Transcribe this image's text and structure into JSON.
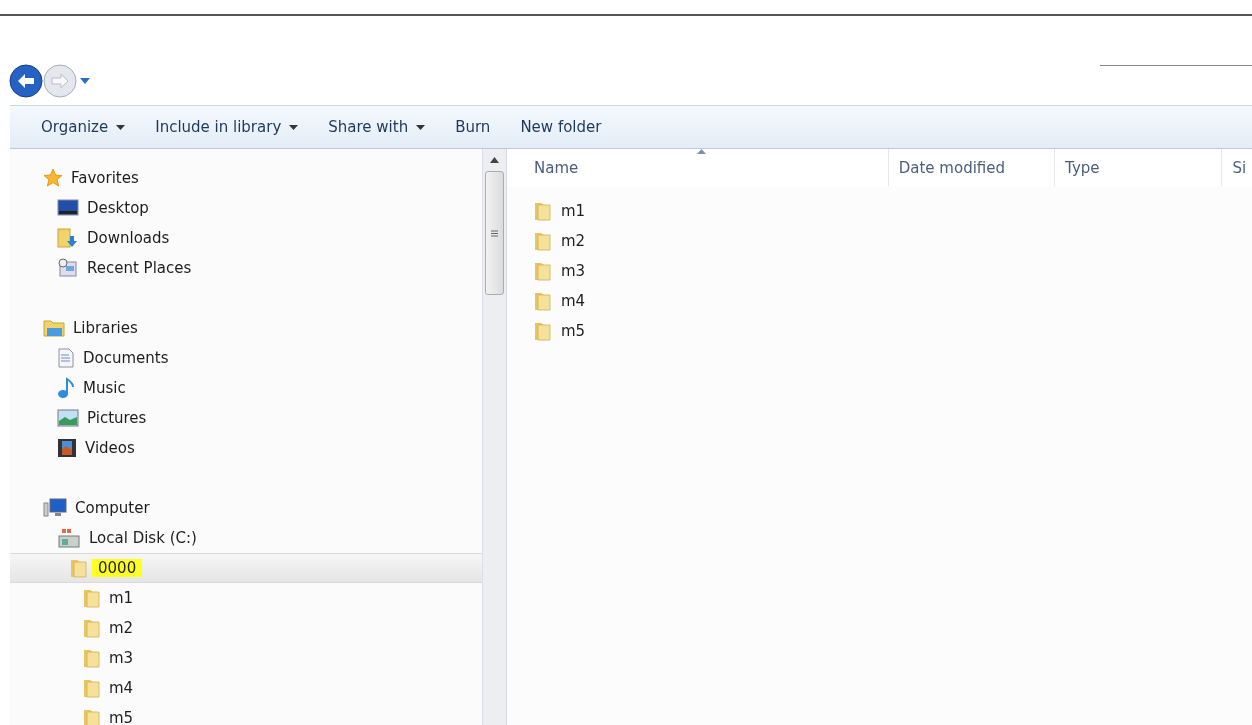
{
  "navigation": {
    "back_enabled": true,
    "forward_enabled": false
  },
  "toolbar": [
    {
      "label": "Organize",
      "dropdown": true
    },
    {
      "label": "Include in library",
      "dropdown": true
    },
    {
      "label": "Share with",
      "dropdown": true
    },
    {
      "label": "Burn",
      "dropdown": false
    },
    {
      "label": "New folder",
      "dropdown": false
    }
  ],
  "nav_pane": {
    "sections": [
      {
        "label": "Favorites",
        "kind": "star",
        "items": [
          {
            "label": "Desktop",
            "kind": "desktop",
            "selected": false
          },
          {
            "label": "Downloads",
            "kind": "downloads",
            "selected": false
          },
          {
            "label": "Recent Places",
            "kind": "recent",
            "selected": false
          }
        ]
      },
      {
        "label": "Libraries",
        "kind": "libraries",
        "items": [
          {
            "label": "Documents",
            "kind": "documents",
            "selected": false
          },
          {
            "label": "Music",
            "kind": "music",
            "selected": false
          },
          {
            "label": "Pictures",
            "kind": "pictures",
            "selected": false
          },
          {
            "label": "Videos",
            "kind": "videos",
            "selected": false
          }
        ]
      },
      {
        "label": "Computer",
        "kind": "computer",
        "items": [
          {
            "label": "Local Disk (C:)",
            "kind": "drive",
            "selected": false,
            "children": [
              {
                "label": "0000",
                "kind": "folder",
                "selected": true,
                "highlighted": true,
                "children": [
                  {
                    "label": "m1",
                    "kind": "folder",
                    "selected": false
                  },
                  {
                    "label": "m2",
                    "kind": "folder",
                    "selected": false
                  },
                  {
                    "label": "m3",
                    "kind": "folder",
                    "selected": false
                  },
                  {
                    "label": "m4",
                    "kind": "folder",
                    "selected": false
                  },
                  {
                    "label": "m5",
                    "kind": "folder",
                    "selected": false
                  }
                ]
              }
            ]
          }
        ]
      }
    ]
  },
  "file_list": {
    "columns": [
      {
        "label": "Name",
        "sorted": true
      },
      {
        "label": "Date modified",
        "sorted": false
      },
      {
        "label": "Type",
        "sorted": false
      },
      {
        "label": "Si",
        "sorted": false
      }
    ],
    "rows": [
      {
        "name": "m1",
        "kind": "folder"
      },
      {
        "name": "m2",
        "kind": "folder"
      },
      {
        "name": "m3",
        "kind": "folder"
      },
      {
        "name": "m4",
        "kind": "folder"
      },
      {
        "name": "m5",
        "kind": "folder"
      }
    ]
  }
}
